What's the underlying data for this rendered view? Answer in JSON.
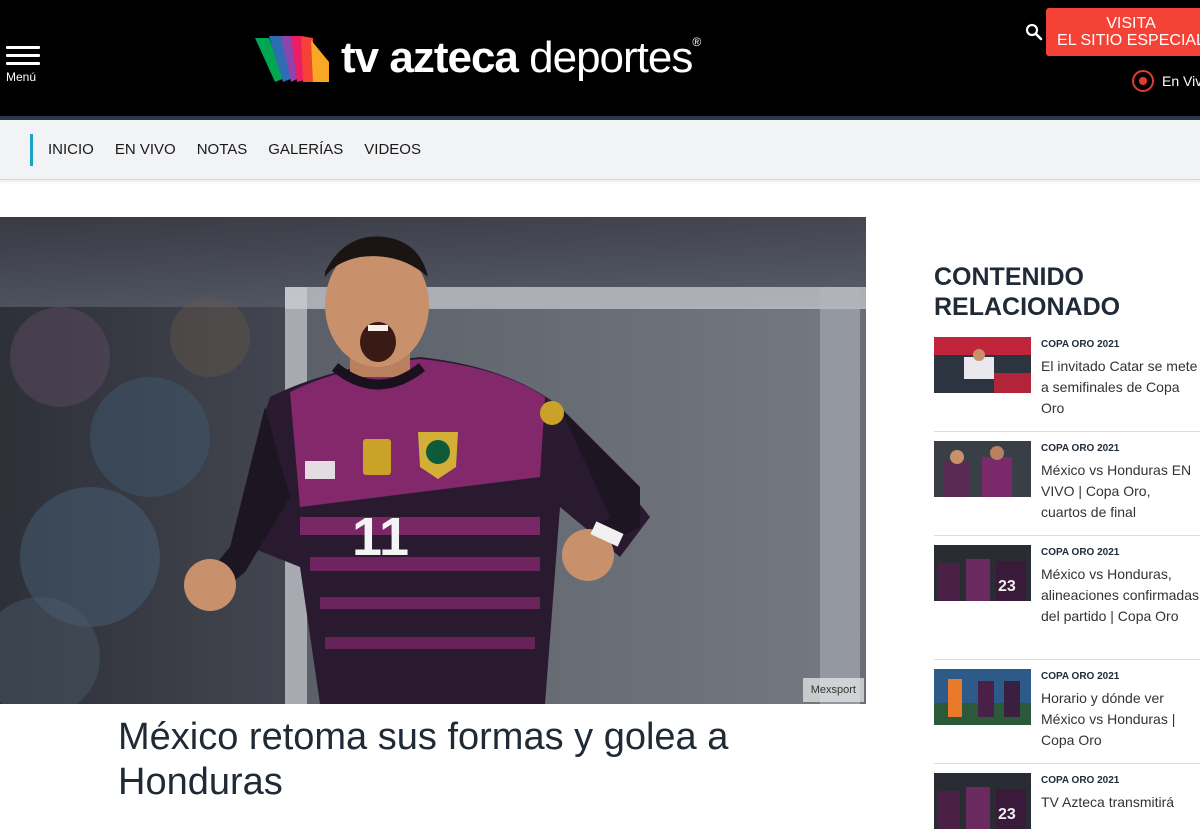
{
  "header": {
    "menu_label": "Menú",
    "logo_bold": "tv azteca",
    "logo_light": "deportes",
    "logo_reg": "®",
    "visit_line1": "VISITA",
    "visit_line2": "EL SITIO ESPECIAL",
    "live_label": "En Vivo"
  },
  "nav": {
    "items": [
      "INICIO",
      "EN VIVO",
      "NOTAS",
      "GALERÍAS",
      "VIDEOS"
    ]
  },
  "hero": {
    "jersey_number": "11",
    "photo_credit": "Mexsport"
  },
  "article": {
    "title": "México retoma sus formas y golea a Honduras"
  },
  "sidebar": {
    "title": "CONTENIDO RELACIONADO",
    "items": [
      {
        "category": "COPA ORO 2021",
        "headline": "El invitado Catar se mete a semifinales de Copa Oro"
      },
      {
        "category": "COPA ORO 2021",
        "headline": "México vs Honduras EN VIVO | Copa Oro, cuartos de final"
      },
      {
        "category": "COPA ORO 2021",
        "headline": "México vs Honduras, alineaciones confirmadas del partido | Copa Oro"
      },
      {
        "category": "COPA ORO 2021",
        "headline": "Horario y dónde ver México vs Honduras | Copa Oro"
      },
      {
        "category": "COPA ORO 2021",
        "headline": "TV Azteca transmitirá"
      }
    ]
  },
  "colors": {
    "header_bg": "#000000",
    "visit_button": "#f44336",
    "live_dot": "#e53935",
    "nav_accent": "#19a3c9",
    "title_text": "#1f2a36"
  }
}
